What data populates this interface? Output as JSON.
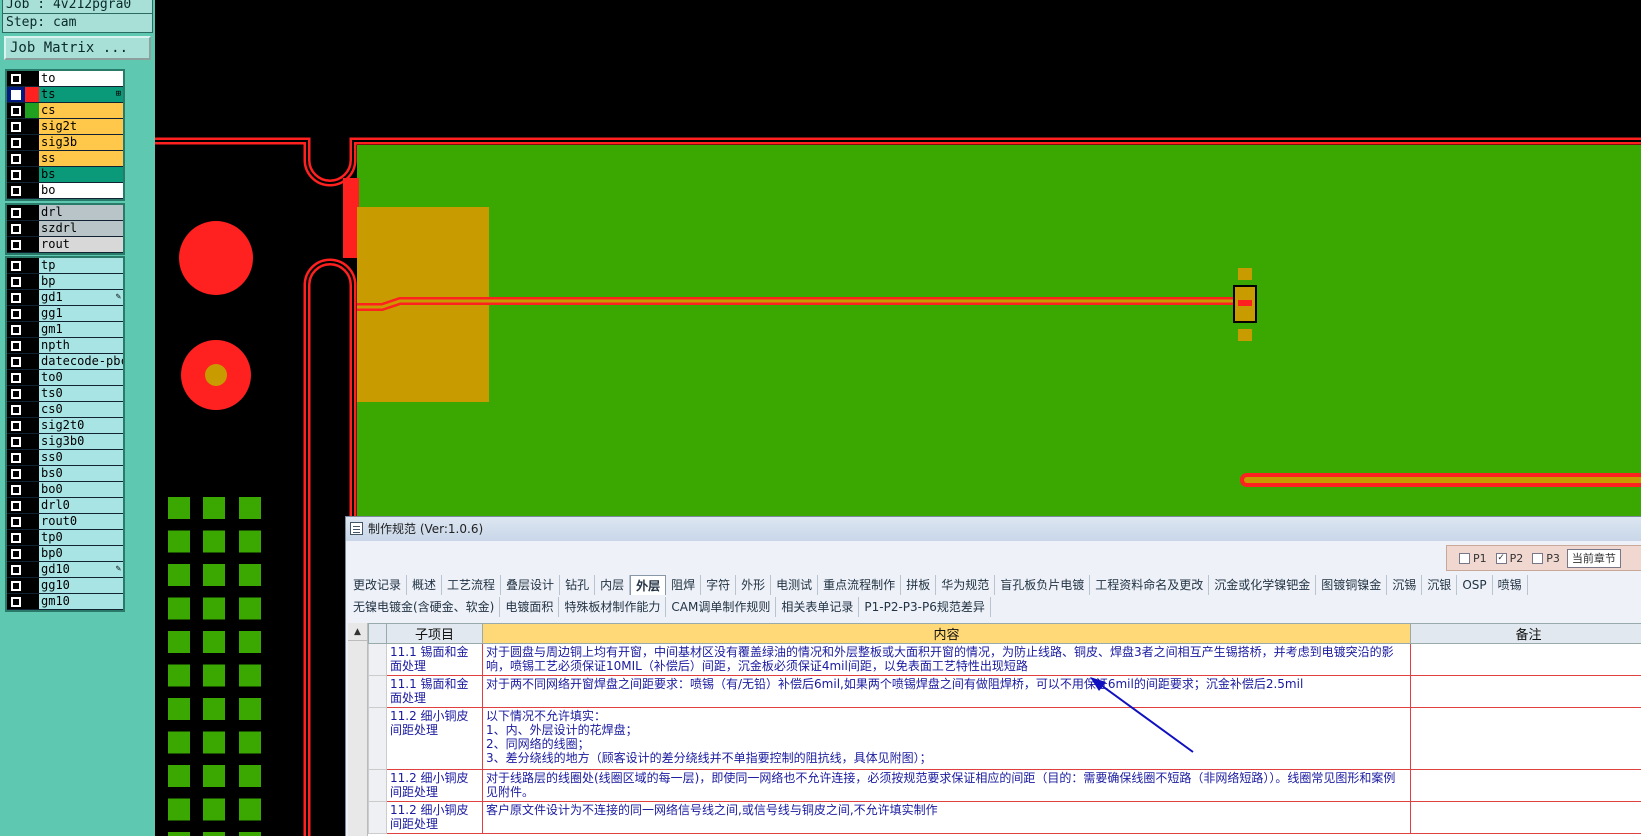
{
  "panel": {
    "job": "Job : 4v212pgra0",
    "step": "Step: cam",
    "job_matrix": "Job Matrix ...",
    "groups": [
      [
        {
          "name": "to",
          "color": "white",
          "sw": "#000"
        },
        {
          "name": "ts",
          "color": "green",
          "sw": "#ff2020",
          "selected": true,
          "mark": "⊞"
        },
        {
          "name": "cs",
          "color": "yellow",
          "sw": "#20a020"
        },
        {
          "name": "sig2t",
          "color": "yellow",
          "sw": "#000"
        },
        {
          "name": "sig3b",
          "color": "yellow",
          "sw": "#000"
        },
        {
          "name": "ss",
          "color": "yellow",
          "sw": "#000"
        },
        {
          "name": "bs",
          "color": "green",
          "sw": "#000"
        },
        {
          "name": "bo",
          "color": "white",
          "sw": "#000"
        }
      ],
      [
        {
          "name": "drl",
          "color": "gray",
          "sw": "#000"
        },
        {
          "name": "szdrl",
          "color": "gray",
          "sw": "#000"
        },
        {
          "name": "rout",
          "color": "lgray",
          "sw": "#000"
        }
      ],
      [
        {
          "name": "tp",
          "color": "cyan",
          "sw": "#000"
        },
        {
          "name": "bp",
          "color": "cyan",
          "sw": "#000"
        },
        {
          "name": "gd1",
          "color": "cyan",
          "sw": "#000",
          "mark": "✎"
        },
        {
          "name": "gg1",
          "color": "cyan",
          "sw": "#000"
        },
        {
          "name": "gm1",
          "color": "cyan",
          "sw": "#000"
        },
        {
          "name": "npth",
          "color": "cyan",
          "sw": "#000"
        },
        {
          "name": "datecode-pbc",
          "color": "cyan",
          "sw": "#000"
        },
        {
          "name": "to0",
          "color": "cyan",
          "sw": "#000"
        },
        {
          "name": "ts0",
          "color": "cyan",
          "sw": "#000"
        },
        {
          "name": "cs0",
          "color": "cyan",
          "sw": "#000"
        },
        {
          "name": "sig2t0",
          "color": "cyan",
          "sw": "#000"
        },
        {
          "name": "sig3b0",
          "color": "cyan",
          "sw": "#000"
        },
        {
          "name": "ss0",
          "color": "cyan",
          "sw": "#000"
        },
        {
          "name": "bs0",
          "color": "cyan",
          "sw": "#000"
        },
        {
          "name": "bo0",
          "color": "cyan",
          "sw": "#000"
        },
        {
          "name": "drl0",
          "color": "cyan",
          "sw": "#000"
        },
        {
          "name": "rout0",
          "color": "cyan",
          "sw": "#000"
        },
        {
          "name": "tp0",
          "color": "cyan",
          "sw": "#000"
        },
        {
          "name": "bp0",
          "color": "cyan",
          "sw": "#000"
        },
        {
          "name": "gd10",
          "color": "cyan",
          "sw": "#000",
          "mark": "✎"
        },
        {
          "name": "gg10",
          "color": "cyan",
          "sw": "#000"
        },
        {
          "name": "gm10",
          "color": "cyan",
          "sw": "#000"
        }
      ]
    ]
  },
  "dialog": {
    "title": "制作规范 (Ver:1.0.6)",
    "pages": [
      "P1",
      "P2",
      "P3"
    ],
    "page_checked": [
      false,
      true,
      false
    ],
    "chapter": "当前章节",
    "tabs_row1": [
      "更改记录",
      "概述",
      "工艺流程",
      "叠层设计",
      "钻孔",
      "内层",
      "外层",
      "阻焊",
      "字符",
      "外形",
      "电测试",
      "重点流程制作",
      "拼板",
      "华为规范",
      "盲孔板负片电镀",
      "工程资料命名及更改",
      "沉金或化学镍钯金",
      "图镀铜镍金",
      "沉锡",
      "沉银",
      "OSP",
      "喷锡"
    ],
    "active_tab": "外层",
    "tabs_row2": [
      "无镍电镀金(含硬金、软金)",
      "电镀面积",
      "特殊板材制作能力",
      "CAM调单制作规则",
      "相关表单记录",
      "P1-P2-P3-P6规范差异"
    ],
    "columns": {
      "sub": "子项目",
      "content": "内容",
      "note": "备注"
    },
    "rows": [
      {
        "sub": "11.1 锡面和金面处理",
        "content": "对于圆盘与周边铜上均有开窗，中间基材区没有覆盖绿油的情况和外层整板或大面积开窗的情况，为防止线路、铜皮、焊盘3者之间相互产生锡搭桥，并考虑到电镀突沿的影响，喷锡工艺必须保证10MIL（补偿后）间距，沉金板必须保证4mil间距，以免表面工艺特性出现短路",
        "note": ""
      },
      {
        "sub": "11.1 锡面和金面处理",
        "content": "对于两不同网络开窗焊盘之间距要求：喷锡（有/无铅）补偿后6mil,如果两个喷锡焊盘之间有做阻焊桥，可以不用保证6mil的间距要求；沉金补偿后2.5mil",
        "note": ""
      },
      {
        "sub": "11.2 细小铜皮间距处理",
        "content": "以下情况不允许填实：\n1、内、外层设计的花焊盘；\n2、同网络的线圈；\n3、差分绕线的地方（顾客设计的差分绕线并不单指要控制的阻抗线，具体见附图）；",
        "note": ""
      },
      {
        "sub": "11.2 细小铜皮间距处理",
        "content": "对于线路层的线圈处(线圈区域的每一层)，即使同一网络也不允许连接，必须按规范要求保证相应的间距（目的：需要确保线圈不短路（非网络短路））。线圈常见图形和案例见附件。",
        "note": ""
      },
      {
        "sub": "11.2 细小铜皮间距处理",
        "content": "客户原文件设计为不连接的同一网络信号线之间,或信号线与铜皮之间,不允许填实制作",
        "note": ""
      }
    ]
  }
}
